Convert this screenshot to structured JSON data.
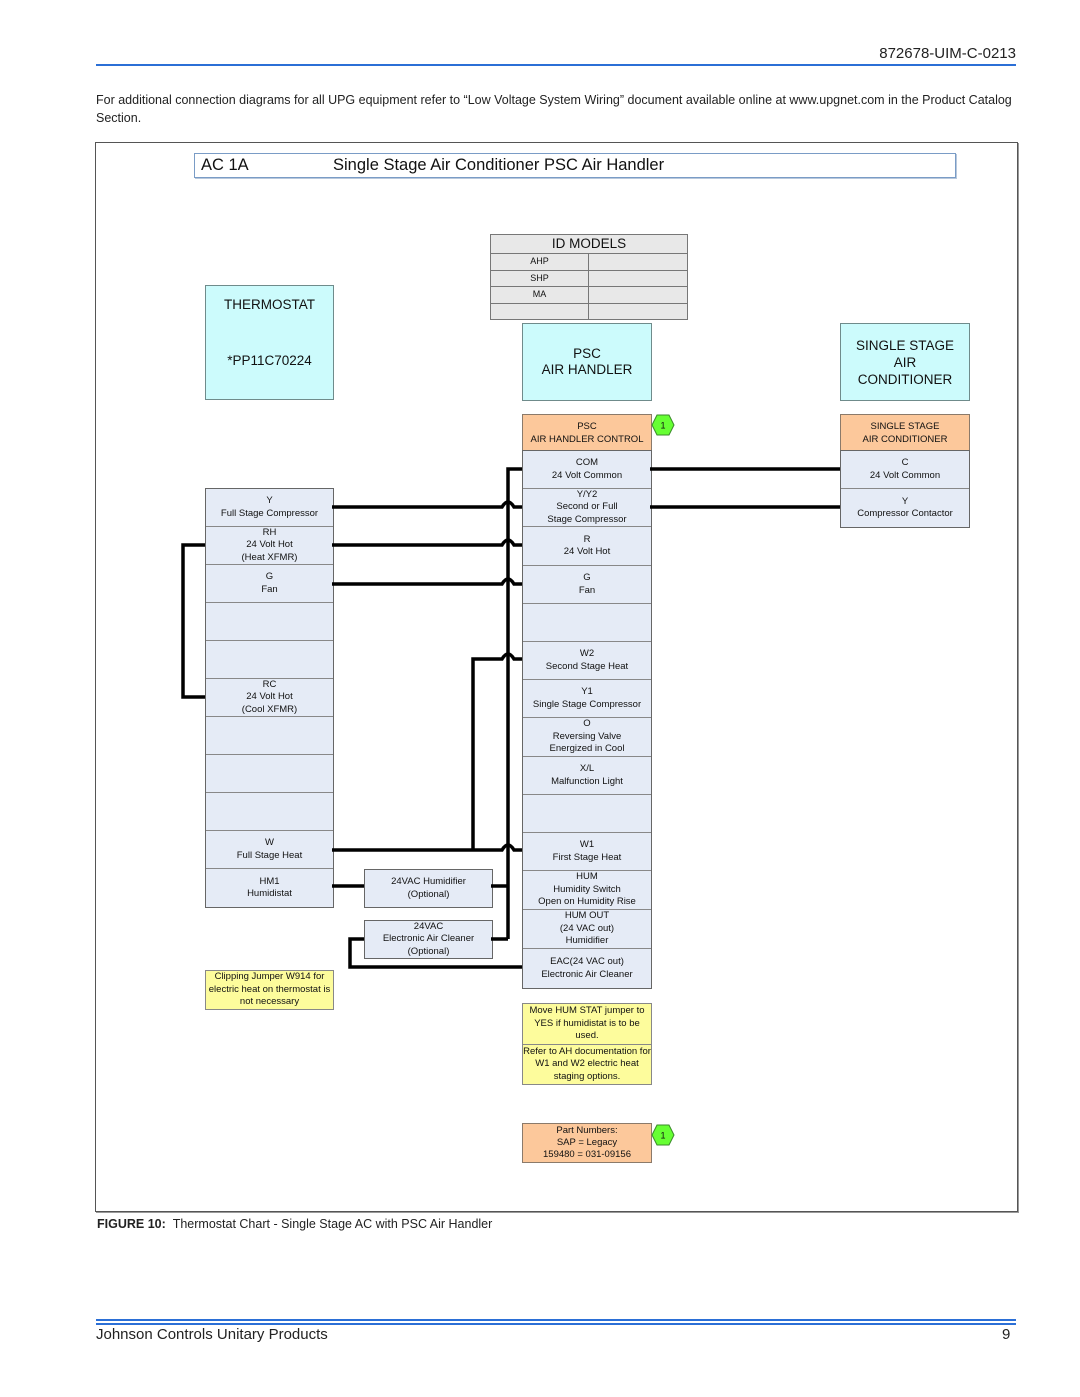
{
  "header": {
    "doc_number": "872678-UIM-C-0213"
  },
  "intro_text": "For additional connection diagrams for all UPG equipment refer to “Low Voltage System Wiring” document available online at www.upgnet.com in the Product Catalog Section.",
  "diagram": {
    "code": "AC 1A",
    "title": "Single Stage Air Conditioner PSC Air Handler",
    "id_models": {
      "header": "ID MODELS",
      "rows": [
        [
          "AHP",
          ""
        ],
        [
          "SHP",
          ""
        ],
        [
          "MA",
          ""
        ],
        [
          "",
          ""
        ]
      ]
    },
    "thermostat": {
      "header": "THERMOSTAT",
      "model": "*PP11C70224",
      "terminals": [
        {
          "name": "Y",
          "desc": [
            "Full Stage Compressor"
          ]
        },
        {
          "name": "RH",
          "desc": [
            "24   Volt Hot",
            "(Heat XFMR)"
          ]
        },
        {
          "name": "G",
          "desc": [
            "Fan"
          ]
        },
        {
          "name": "",
          "desc": []
        },
        {
          "name": "",
          "desc": []
        },
        {
          "name": "RC",
          "desc": [
            "24   Volt Hot",
            "(Cool XFMR)"
          ]
        },
        {
          "name": "",
          "desc": []
        },
        {
          "name": "",
          "desc": []
        },
        {
          "name": "",
          "desc": []
        },
        {
          "name": "W",
          "desc": [
            "Full Stage Heat"
          ]
        },
        {
          "name": "HM1",
          "desc": [
            "Humidistat"
          ]
        }
      ],
      "note": "Clipping Jumper W914 for electric heat on thermostat is not necessary"
    },
    "air_handler": {
      "header_line1": "PSC",
      "header_line2": "AIR HANDLER",
      "control_line1": "PSC",
      "control_line2": "AIR HANDLER CONTROL",
      "badge": "1",
      "terminals": [
        {
          "name": "COM",
          "desc": [
            "24   Volt Common"
          ]
        },
        {
          "name": "Y/Y2",
          "desc": [
            "Second or Full",
            "Stage Compressor"
          ]
        },
        {
          "name": "R",
          "desc": [
            "24   Volt Hot"
          ]
        },
        {
          "name": "G",
          "desc": [
            "Fan"
          ]
        },
        {
          "name": "",
          "desc": []
        },
        {
          "name": "W2",
          "desc": [
            "Second Stage Heat"
          ]
        },
        {
          "name": "Y1",
          "desc": [
            "Single Stage Compressor"
          ]
        },
        {
          "name": "O",
          "desc": [
            "Reversing Valve",
            "Energized in Cool"
          ]
        },
        {
          "name": "X/L",
          "desc": [
            "Malfunction Light"
          ]
        },
        {
          "name": "",
          "desc": []
        },
        {
          "name": "W1",
          "desc": [
            "First Stage Heat"
          ]
        },
        {
          "name": "HUM",
          "desc": [
            "Humidity Switch",
            "Open on Humidity Rise"
          ]
        },
        {
          "name": "HUM OUT",
          "desc": [
            "(24 VAC out)",
            "Humidifier"
          ]
        },
        {
          "name": "EAC(24 VAC out)",
          "desc": [
            "Electronic Air Cleaner"
          ]
        }
      ],
      "note_parts": [
        "Move HUM STAT jumper to  YES if humidistat is to be used.",
        "Refer to AH documentation for W1 and W2 electric heat staging options."
      ],
      "part_numbers": {
        "line1": "Part Numbers:",
        "line2": "SAP   =    Legacy",
        "line3": "159480  =  031-09156",
        "badge": "1"
      }
    },
    "condenser": {
      "header_line1": "SINGLE STAGE",
      "header_line2": "AIR",
      "header_line3": "CONDITIONER",
      "control_line1": "SINGLE STAGE",
      "control_line2": "AIR CONDITIONER",
      "terminals": [
        {
          "name": "C",
          "desc": [
            "24   Volt Common"
          ]
        },
        {
          "name": "Y",
          "desc": [
            "Compressor Contactor"
          ]
        }
      ]
    },
    "accessories": {
      "humidifier_line1": "24VAC Humidifier",
      "humidifier_line2": "(Optional)",
      "cleaner_line1": "24VAC",
      "cleaner_line2": "Electronic Air Cleaner",
      "cleaner_line3": "(Optional)"
    },
    "colors": {
      "cyan_box": "#ccfbfc",
      "orange_box": "#fcc89b",
      "terminal_box": "#e5ebf6",
      "note_box": "#fdfc9c",
      "badge_green": "#66ff33",
      "rule_blue": "#2b6fd6"
    }
  },
  "caption": {
    "label": "FIGURE 10:",
    "text": "Thermostat Chart - Single Stage AC with PSC Air Handler"
  },
  "footer": {
    "company": "Johnson Controls Unitary Products",
    "page": "9"
  }
}
